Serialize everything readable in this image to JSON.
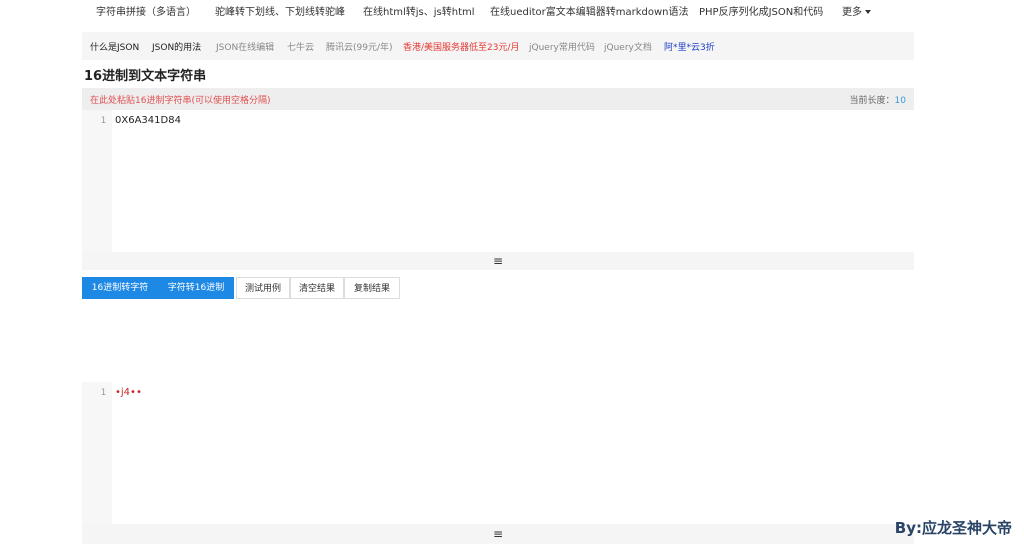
{
  "top_nav": {
    "items": [
      "字符串拼接（多语言）",
      "驼峰转下划线、下划线转驼峰",
      "在线html转js、js转html",
      "在线ueditor富文本编辑器转markdown语法",
      "PHP反序列化成JSON和代码"
    ],
    "more_label": "更多"
  },
  "sub_nav": {
    "links": [
      "什么是JSON",
      "JSON的用法",
      "JSON在线编辑",
      "七牛云",
      "腾讯云(99元/年)",
      "香港/美国服务器低至23元/月",
      "jQuery常用代码",
      "jQuery文档",
      "阿*里*云3折"
    ]
  },
  "page": {
    "title": "16进制到文本字符串"
  },
  "input_editor": {
    "hint": "在此处粘贴16进制字符串(可以使用空格分隔)",
    "length_label": "当前长度：",
    "length_value": "10",
    "line_number": "1",
    "content": "0X6A341D84",
    "resize_icon": "≡"
  },
  "buttons": {
    "hex_to_string": "16进制转字符",
    "string_to_hex": "字符转16进制",
    "test_case": "测试用例",
    "clear_result": "清空结果",
    "copy_result": "复制结果"
  },
  "output_editor": {
    "line_number": "1",
    "content": "•j4••",
    "resize_icon": "≡"
  },
  "watermark": "By:应龙圣神大帝",
  "colors": {
    "primary": "#1e88e5",
    "hint_red": "#e05050",
    "ad_red": "#e53935",
    "ad_blue": "#1e40c8",
    "length_blue": "#3a9bd8"
  }
}
